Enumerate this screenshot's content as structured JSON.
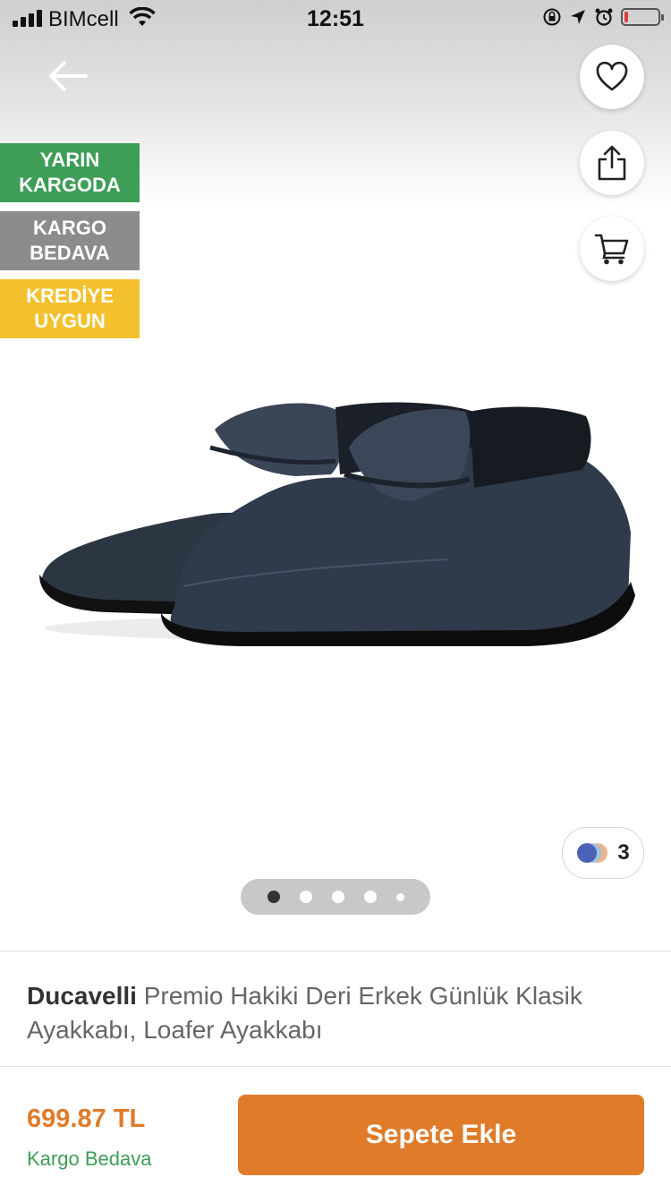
{
  "status_bar": {
    "carrier": "BIMcell",
    "time": "12:51",
    "battery_level": 0.1
  },
  "badges": [
    {
      "line1": "YARIN",
      "line2": "KARGODA",
      "color": "#3e9d57"
    },
    {
      "line1": "KARGO",
      "line2": "BEDAVA",
      "color": "#8c8c8c"
    },
    {
      "line1": "KREDİYE",
      "line2": "UYGUN",
      "color": "#f4c12e"
    }
  ],
  "icons": {
    "back": "arrow-left-icon",
    "favorite": "heart-icon",
    "share": "share-icon",
    "cart": "cart-icon"
  },
  "gallery": {
    "variant_count": "3",
    "page_count": 5,
    "active_page": 1
  },
  "product": {
    "brand": "Ducavelli",
    "name": "Premio Hakiki Deri Erkek Günlük Klasik Ayakkabı, Loafer Ayakkabı"
  },
  "purchase": {
    "price": "699.87 TL",
    "shipping": "Kargo Bedava",
    "button_label": "Sepete Ekle"
  },
  "colors": {
    "accent": "#e07b2a",
    "success": "#3e9d57"
  }
}
